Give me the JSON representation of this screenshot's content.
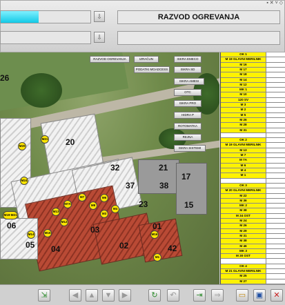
{
  "header": {
    "title": "RAZVOD OGREVANJA",
    "progress": 0.42
  },
  "map_buttons": [
    {
      "label": "RAZVOD OGREVANJA"
    },
    {
      "label": "IZRAČUN"
    },
    {
      "label": "ISKRA EMECO"
    },
    {
      "label": "PODATKI MGADCESS"
    },
    {
      "label": "ISKRA SD"
    },
    {
      "label": "ISKRA AMESI"
    },
    {
      "label": "OTC"
    },
    {
      "label": "ISKRA PRO"
    },
    {
      "label": "HIDRA P"
    },
    {
      "label": "ROTOMATKA"
    },
    {
      "label": "REJNA"
    },
    {
      "label": "ISKRA SISTEMI"
    }
  ],
  "building_numbers": [
    "26",
    "20",
    "32",
    "21",
    "17",
    "37",
    "38",
    "23",
    "15",
    "06",
    "05",
    "04",
    "03",
    "01",
    "02",
    "42"
  ],
  "markers": [
    "M21",
    "M20",
    "M24",
    "M19-M21",
    "M7A",
    "M7",
    "M8",
    "M6",
    "M3",
    "M4",
    "M13",
    "M14",
    "M12",
    "M15",
    "M16",
    "M1"
  ],
  "table": {
    "rows": [
      {
        "label": "OK 1",
        "type": "head"
      },
      {
        "label": "M 19 GLAVNI MERILNIK",
        "type": "head"
      },
      {
        "label": "M 16"
      },
      {
        "label": "M 17"
      },
      {
        "label": "M 18"
      },
      {
        "label": "M 14"
      },
      {
        "label": "M 12"
      },
      {
        "label": "MK 1"
      },
      {
        "label": "M 10"
      },
      {
        "label": "120 SV"
      },
      {
        "label": "M 3"
      },
      {
        "label": "M 2"
      },
      {
        "label": "M 5"
      },
      {
        "label": "M 26"
      },
      {
        "label": "M 28"
      },
      {
        "label": "M 31"
      },
      {
        "label": "",
        "type": "blank"
      },
      {
        "label": "OK 2",
        "type": "head"
      },
      {
        "label": "M 19 GLAVNI MERILNIK",
        "type": "head"
      },
      {
        "label": "M 13"
      },
      {
        "label": "M 7"
      },
      {
        "label": "M 7A"
      },
      {
        "label": "M 6"
      },
      {
        "label": "M 4"
      },
      {
        "label": "M 1"
      },
      {
        "label": "",
        "type": "blank"
      },
      {
        "label": "OK 3",
        "type": "head"
      },
      {
        "label": "M 20 GLAVNI MERILNIK",
        "type": "head"
      },
      {
        "label": "M 22"
      },
      {
        "label": "M 36"
      },
      {
        "label": "MK 2"
      },
      {
        "label": "M 38"
      },
      {
        "label": "M 34 OST"
      },
      {
        "label": "M 24"
      },
      {
        "label": "M 26"
      },
      {
        "label": "M 29"
      },
      {
        "label": "M 31"
      },
      {
        "label": "M 38"
      },
      {
        "label": "M 46"
      },
      {
        "label": "MK 3"
      },
      {
        "label": "M 30 OST"
      },
      {
        "label": "",
        "type": "blank"
      },
      {
        "label": "OK 4",
        "type": "head"
      },
      {
        "label": "M 21 GLAVNI MERILNIK",
        "type": "head"
      },
      {
        "label": "M 25"
      },
      {
        "label": "M 27"
      }
    ]
  },
  "toolbar": {
    "icons": [
      "import-icon",
      "nav-left-icon",
      "nav-up-icon",
      "nav-down-icon",
      "nav-right-icon",
      "refresh-icon",
      "undo-icon",
      "export-icon",
      "forward-icon",
      "folder-open-icon",
      "save-icon",
      "close-icon"
    ]
  },
  "colors": {
    "progress": "#12c9e6",
    "marker": "#ffe600",
    "table_cell": "#fff200"
  }
}
